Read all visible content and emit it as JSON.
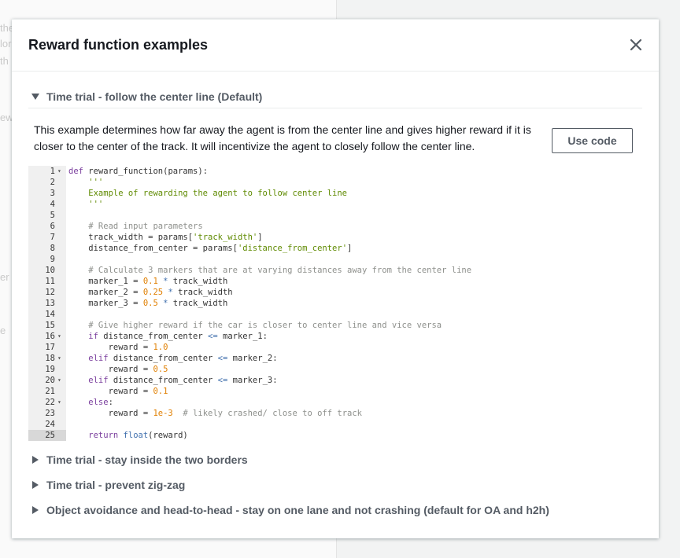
{
  "background": {
    "fragments": [
      "the",
      "lor",
      "th",
      "ew",
      "er",
      "e"
    ]
  },
  "modal": {
    "title": "Reward function examples",
    "close_icon": "close-icon"
  },
  "examples": [
    {
      "label": "Time trial - follow the center line (Default)",
      "expanded": true
    },
    {
      "label": "Time trial - stay inside the two borders",
      "expanded": false
    },
    {
      "label": "Time trial - prevent zig-zag",
      "expanded": false
    },
    {
      "label": "Object avoidance and head-to-head - stay on one lane and not crashing (default for OA and h2h)",
      "expanded": false
    }
  ],
  "selected_example": {
    "description": "This example determines how far away the agent is from the center line and gives higher reward if it is closer to the center of the track. It will incentivize the agent to closely follow the center line.",
    "use_code_label": "Use code",
    "active_line": 25,
    "code": [
      {
        "n": "1",
        "fold": true,
        "t": [
          [
            "k",
            "def "
          ],
          [
            "p",
            "reward_function(params):"
          ]
        ]
      },
      {
        "n": "2",
        "t": [
          [
            "s",
            "    '''"
          ]
        ]
      },
      {
        "n": "3",
        "t": [
          [
            "s",
            "    Example of rewarding the agent to follow center line"
          ]
        ]
      },
      {
        "n": "4",
        "t": [
          [
            "s",
            "    '''"
          ]
        ]
      },
      {
        "n": "5",
        "t": []
      },
      {
        "n": "6",
        "t": [
          [
            "c",
            "    # Read input parameters"
          ]
        ]
      },
      {
        "n": "7",
        "t": [
          [
            "p",
            "    track_width = params["
          ],
          [
            "s",
            "'track_width'"
          ],
          [
            "p",
            "]"
          ]
        ]
      },
      {
        "n": "8",
        "t": [
          [
            "p",
            "    distance_from_center = params["
          ],
          [
            "s",
            "'distance_from_center'"
          ],
          [
            "p",
            "]"
          ]
        ]
      },
      {
        "n": "9",
        "t": []
      },
      {
        "n": "10",
        "t": [
          [
            "c",
            "    # Calculate 3 markers that are at varying distances away from the center line"
          ]
        ]
      },
      {
        "n": "11",
        "t": [
          [
            "p",
            "    marker_1 = "
          ],
          [
            "n",
            "0.1"
          ],
          [
            "o",
            " * "
          ],
          [
            "p",
            "track_width"
          ]
        ]
      },
      {
        "n": "12",
        "t": [
          [
            "p",
            "    marker_2 = "
          ],
          [
            "n",
            "0.25"
          ],
          [
            "o",
            " * "
          ],
          [
            "p",
            "track_width"
          ]
        ]
      },
      {
        "n": "13",
        "t": [
          [
            "p",
            "    marker_3 = "
          ],
          [
            "n",
            "0.5"
          ],
          [
            "o",
            " * "
          ],
          [
            "p",
            "track_width"
          ]
        ]
      },
      {
        "n": "14",
        "t": []
      },
      {
        "n": "15",
        "t": [
          [
            "c",
            "    # Give higher reward if the car is closer to center line and vice versa"
          ]
        ]
      },
      {
        "n": "16",
        "fold": true,
        "t": [
          [
            "k",
            "    if "
          ],
          [
            "p",
            "distance_from_center "
          ],
          [
            "o",
            "<="
          ],
          [
            "p",
            " marker_1:"
          ]
        ]
      },
      {
        "n": "17",
        "t": [
          [
            "p",
            "        reward = "
          ],
          [
            "n",
            "1.0"
          ]
        ]
      },
      {
        "n": "18",
        "fold": true,
        "t": [
          [
            "k",
            "    elif "
          ],
          [
            "p",
            "distance_from_center "
          ],
          [
            "o",
            "<="
          ],
          [
            "p",
            " marker_2:"
          ]
        ]
      },
      {
        "n": "19",
        "t": [
          [
            "p",
            "        reward = "
          ],
          [
            "n",
            "0.5"
          ]
        ]
      },
      {
        "n": "20",
        "fold": true,
        "t": [
          [
            "k",
            "    elif "
          ],
          [
            "p",
            "distance_from_center "
          ],
          [
            "o",
            "<="
          ],
          [
            "p",
            " marker_3:"
          ]
        ]
      },
      {
        "n": "21",
        "t": [
          [
            "p",
            "        reward = "
          ],
          [
            "n",
            "0.1"
          ]
        ]
      },
      {
        "n": "22",
        "fold": true,
        "t": [
          [
            "k",
            "    else"
          ],
          [
            "p",
            ":"
          ]
        ]
      },
      {
        "n": "23",
        "t": [
          [
            "p",
            "        reward = "
          ],
          [
            "n",
            "1e-3"
          ],
          [
            "c",
            "  # likely crashed/ close to off track"
          ]
        ]
      },
      {
        "n": "24",
        "t": []
      },
      {
        "n": "25",
        "t": [
          [
            "k",
            "    return "
          ],
          [
            "o",
            "float"
          ],
          [
            "p",
            "(reward)"
          ]
        ]
      }
    ]
  }
}
